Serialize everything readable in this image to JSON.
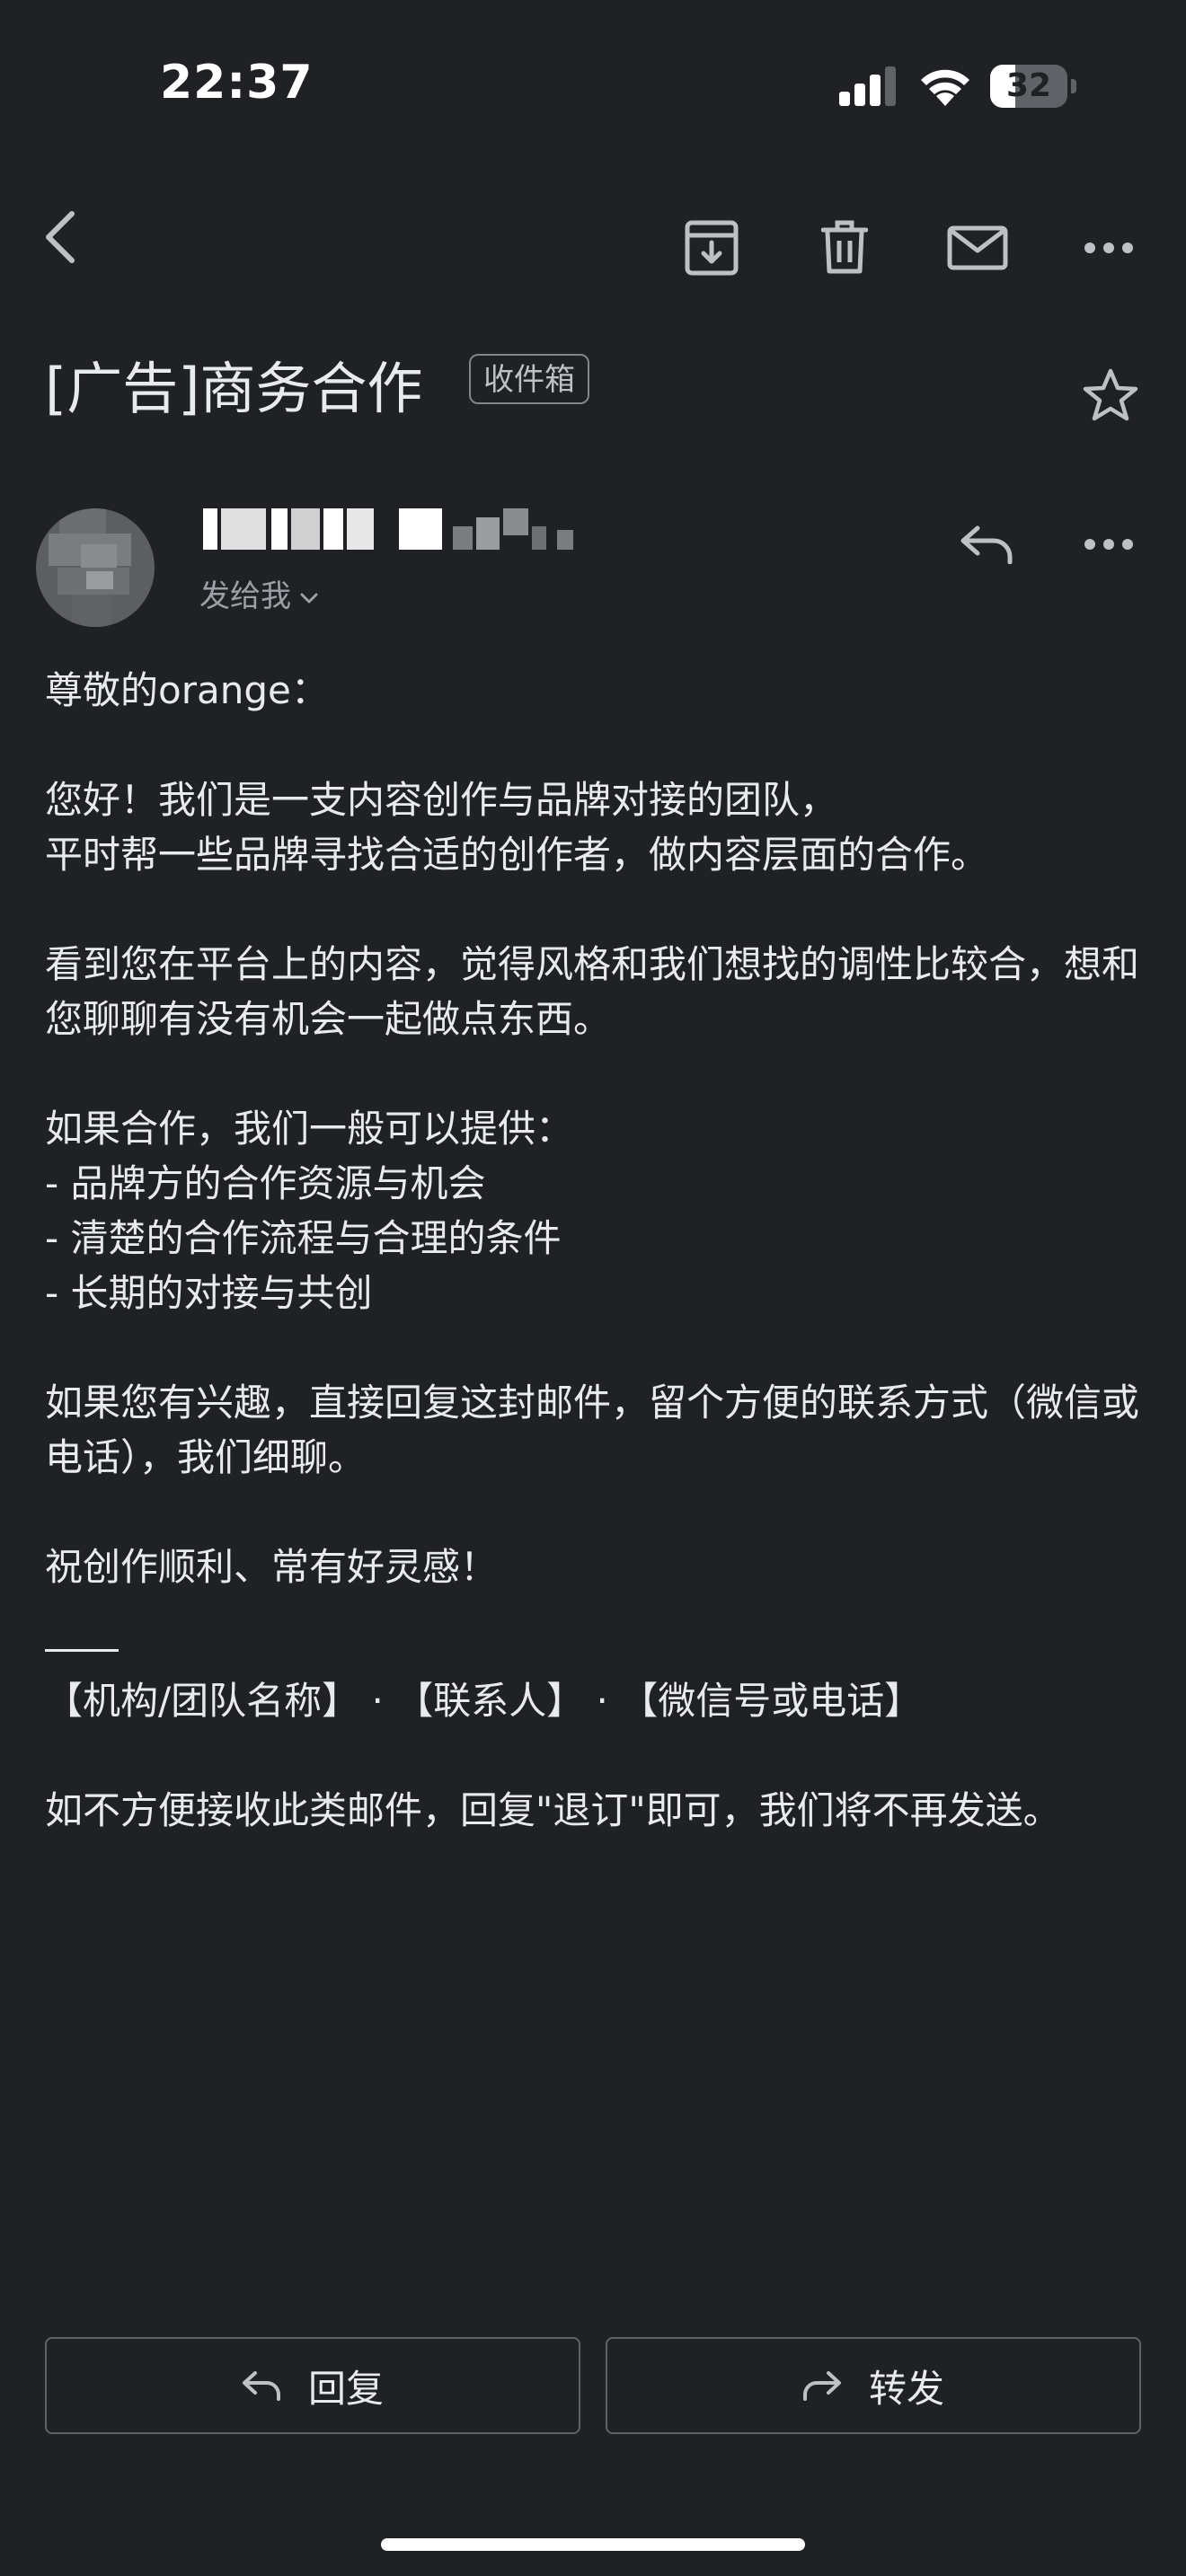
{
  "status_bar": {
    "time": "22:37",
    "battery_level": "32",
    "battery_fraction": 0.32
  },
  "toolbar": {
    "icons": [
      "back-icon",
      "archive-icon",
      "trash-icon",
      "mail-icon",
      "more-horizontal-icon"
    ]
  },
  "email": {
    "subject": "[广告]商务合作",
    "label": "收件箱",
    "sender_meta": "发给我",
    "paragraphs": [
      "尊敬的orange：",
      "您好！我们是一支内容创作与品牌对接的团队，\n平时帮一些品牌寻找合适的创作者，做内容层面的合作。",
      "看到您在平台上的内容，觉得风格和我们想找的调性比较合，想和您聊聊有没有机会一起做点东西。",
      "如果合作，我们一般可以提供：\n- 品牌方的合作资源与机会\n- 清楚的合作流程与合理的条件\n- 长期的对接与共创",
      "如果您有兴趣，直接回复这封邮件，留个方便的联系方式（微信或电话），我们细聊。",
      "祝创作顺利、常有好灵感！"
    ],
    "signature": "【机构/团队名称】 · 【联系人】 · 【微信号或电话】",
    "unsubscribe": "如不方便接收此类邮件，回复\"退订\"即可，我们将不再发送。"
  },
  "actions": {
    "reply_label": "回复",
    "forward_label": "转发"
  },
  "colors": {
    "background": "#202124",
    "text": "#e8eaed",
    "muted": "#9aa0a6",
    "border": "#5f6368"
  }
}
